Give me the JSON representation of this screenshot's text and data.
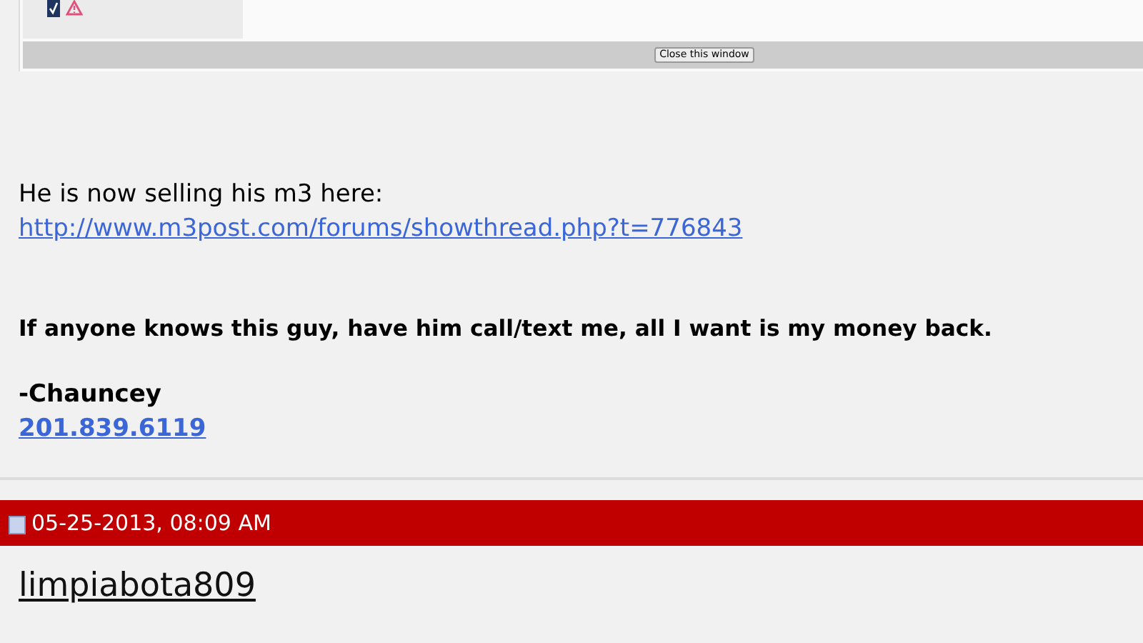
{
  "popup": {
    "close_button": "Close this window"
  },
  "post": {
    "intro": "He is now selling his m3 here:",
    "link": "http://www.m3post.com/forums/showthread.php?t=776843",
    "warning": "If anyone knows this guy, have him call/text me, all I want is my money back.",
    "signature": "-Chauncey",
    "phone": "201.839.6119"
  },
  "next_post": {
    "date": "05-25-2013, 08:09 AM",
    "username": "limpiabota809"
  }
}
